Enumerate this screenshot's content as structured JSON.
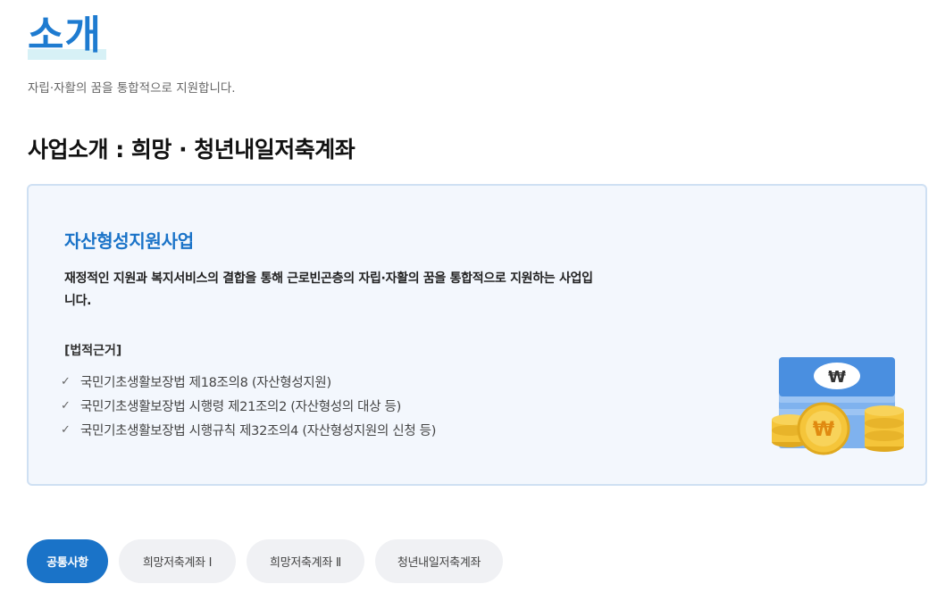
{
  "header": {
    "title": "소개",
    "subtitle": "자립·자활의 꿈을 통합적으로 지원합니다."
  },
  "section": {
    "heading": "사업소개 : 희망 · 청년내일저축계좌"
  },
  "card": {
    "title": "자산형성지원사업",
    "description": "재정적인 지원과 복지서비스의 결합을 통해 근로빈곤층의 자립·자활의 꿈을 통합적으로 지원하는 사업입니다.",
    "legal_title": "[법적근거]",
    "legal_items": [
      "국민기초생활보장법 제18조의8 (자산형성지원)",
      "국민기초생활보장법 시행령 제21조의2 (자산형성의 대상 등)",
      "국민기초생활보장법 시행규칙 제32조의4 (자산형성지원의 신청 등)"
    ],
    "illustration_icon": "money-stack-coins-icon",
    "currency_symbol": "₩"
  },
  "tabs": [
    {
      "label": "공통사항",
      "active": true
    },
    {
      "label": "희망저축계좌 Ⅰ",
      "active": false
    },
    {
      "label": "희망저축계좌 Ⅱ",
      "active": false
    },
    {
      "label": "청년내일저축계좌",
      "active": false
    }
  ],
  "colors": {
    "accent": "#1a73c8",
    "title_blue": "#1e7bd0",
    "card_bg": "#f3f7fd",
    "card_border": "#cfe0f3",
    "coin_gold": "#f5c53a",
    "bill_blue": "#4a8fe0"
  }
}
